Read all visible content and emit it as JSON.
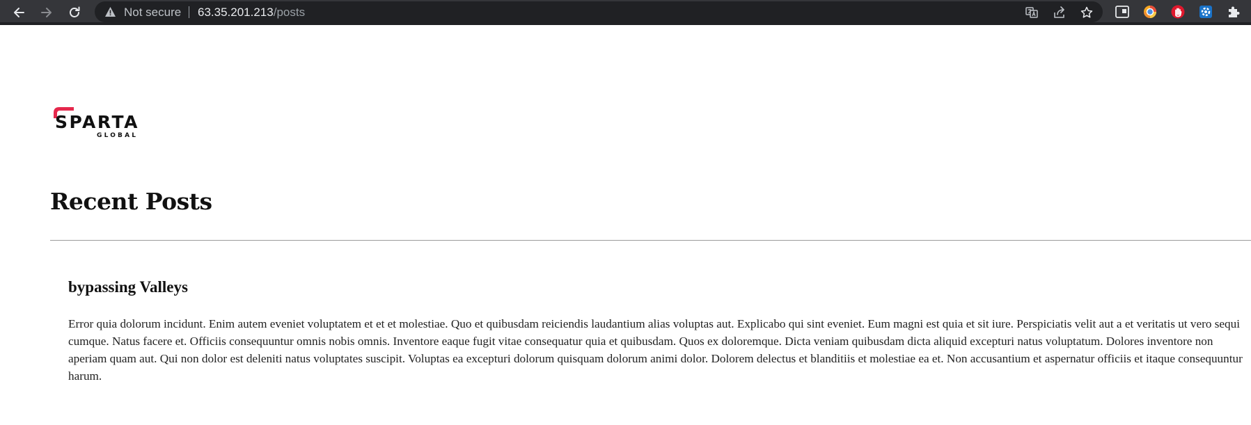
{
  "browser": {
    "security_label": "Not secure",
    "url_host": "63.35.201.213",
    "url_path": "/posts",
    "nav": {
      "back_icon": "arrow-left-icon",
      "forward_icon": "arrow-right-icon",
      "reload_icon": "reload-icon"
    },
    "omnibox_icons": [
      "translate-icon",
      "share-icon",
      "bookmark-star-icon"
    ],
    "extension_icons": [
      "side-panel-icon",
      "color-wheel-extension-icon",
      "red-hand-extension-icon",
      "blue-gear-extension-icon",
      "puzzle-extensions-icon"
    ]
  },
  "brand": {
    "logo_text": "SPARTA",
    "logo_subtext": "GLOBAL",
    "accent_color": "#e5284c"
  },
  "page": {
    "title": "Recent Posts"
  },
  "posts": [
    {
      "title": "bypassing Valleys",
      "body": "Error quia dolorum incidunt. Enim autem eveniet voluptatem et et et molestiae. Quo et quibusdam reiciendis laudantium alias voluptas aut. Explicabo qui sint eveniet. Eum magni est quia et sit iure. Perspiciatis velit aut a et veritatis ut vero sequi cumque. Natus facere et. Officiis consequuntur omnis nobis omnis. Inventore eaque fugit vitae consequatur quia et quibusdam. Quos ex doloremque. Dicta veniam quibusdam dicta aliquid excepturi natus voluptatum. Dolores inventore non aperiam quam aut. Qui non dolor est deleniti natus voluptates suscipit. Voluptas ea excepturi dolorum quisquam dolorum animi dolor. Dolorem delectus et blanditiis et molestiae ea et. Non accusantium et aspernatur officiis et itaque consequuntur harum."
    }
  ]
}
